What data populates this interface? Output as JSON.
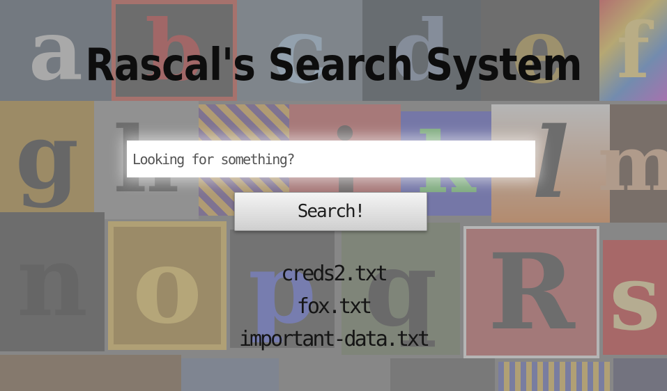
{
  "page": {
    "title": "Rascal's Search System"
  },
  "search": {
    "placeholder": "Looking for something?",
    "button_label": "Search!"
  },
  "results": [
    "creds2.txt",
    "fox.txt",
    "important-data.txt"
  ],
  "background_letters": [
    "a",
    "b",
    "c",
    "d",
    "e",
    "f",
    "g",
    "h",
    "j",
    "k",
    "l",
    "m",
    "n",
    "o",
    "p",
    "q",
    "R",
    "s"
  ],
  "colors": {
    "title": "#0d0d0d",
    "input_bg": "#ffffff",
    "button_top": "#f4f4f4",
    "button_bottom": "#cfcfcf",
    "overlay": "rgba(150,150,150,0.62)"
  }
}
